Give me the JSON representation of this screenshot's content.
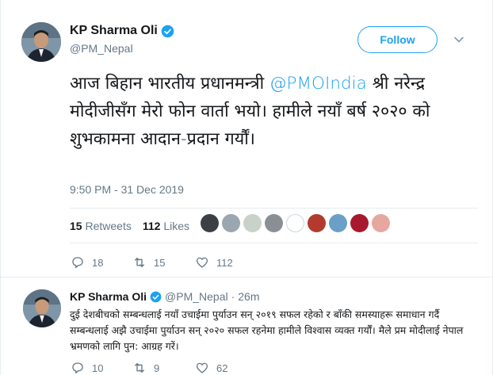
{
  "tweet": {
    "author_name": "KP Sharma Oli",
    "author_handle": "@PM_Nepal",
    "follow_label": "Follow",
    "text_before": "आज बिहान भारतीय प्रधानमन्त्री ",
    "mention": "@PMOIndia",
    "text_after": " श्री नरेन्द्र मोदीजीसँग मेरो फोन वार्ता भयो। हामीले नयाँ बर्ष २०२० को शुभकामना आदान-प्रदान गर्यौं।",
    "timestamp": "9:50 PM - 31 Dec 2019",
    "retweets_count": "15",
    "retweets_label": "Retweets",
    "likes_count": "112",
    "likes_label": "Likes",
    "actions": {
      "reply_count": "18",
      "retweet_count": "15",
      "like_count": "112"
    }
  },
  "reply": {
    "author_name": "KP Sharma Oli",
    "author_handle": "@PM_Nepal",
    "separator": "·",
    "time": "26m",
    "text": "दुई देशबीचको सम्बन्धलाई नयाँ उचाईमा पुर्याउन सन् २०१९ सफल रहेको र बाँकी समस्याहरू समाधान गर्दै सम्बन्धलाई अझै उचाईमा पुर्याउन सन् २०२० सफल रहनेमा हामीले विश्वास व्यक्त गर्यौं। मैले प्रम मोदीलाई नेपाल भ्रमणको लागि पुन: आग्रह गरें।",
    "actions": {
      "reply_count": "10",
      "retweet_count": "9",
      "like_count": "62"
    }
  },
  "colors": {
    "accent": "#1da1f2",
    "secondary_text": "#657786",
    "divider": "#e6ecf0"
  },
  "icons": [
    "verified-icon",
    "chevron-down-icon",
    "reply-icon",
    "retweet-icon",
    "heart-icon"
  ],
  "retweeter_avatars": [
    {
      "color": "#3c3f46"
    },
    {
      "color": "#9aa7b0"
    },
    {
      "color": "#c9d2c8"
    },
    {
      "color": "#8a8f96"
    },
    {
      "color": "#ffffff"
    },
    {
      "color": "#b23a2e"
    },
    {
      "color": "#6aa0c8"
    },
    {
      "color": "#a8192f"
    },
    {
      "color": "#e7a7a1"
    }
  ]
}
